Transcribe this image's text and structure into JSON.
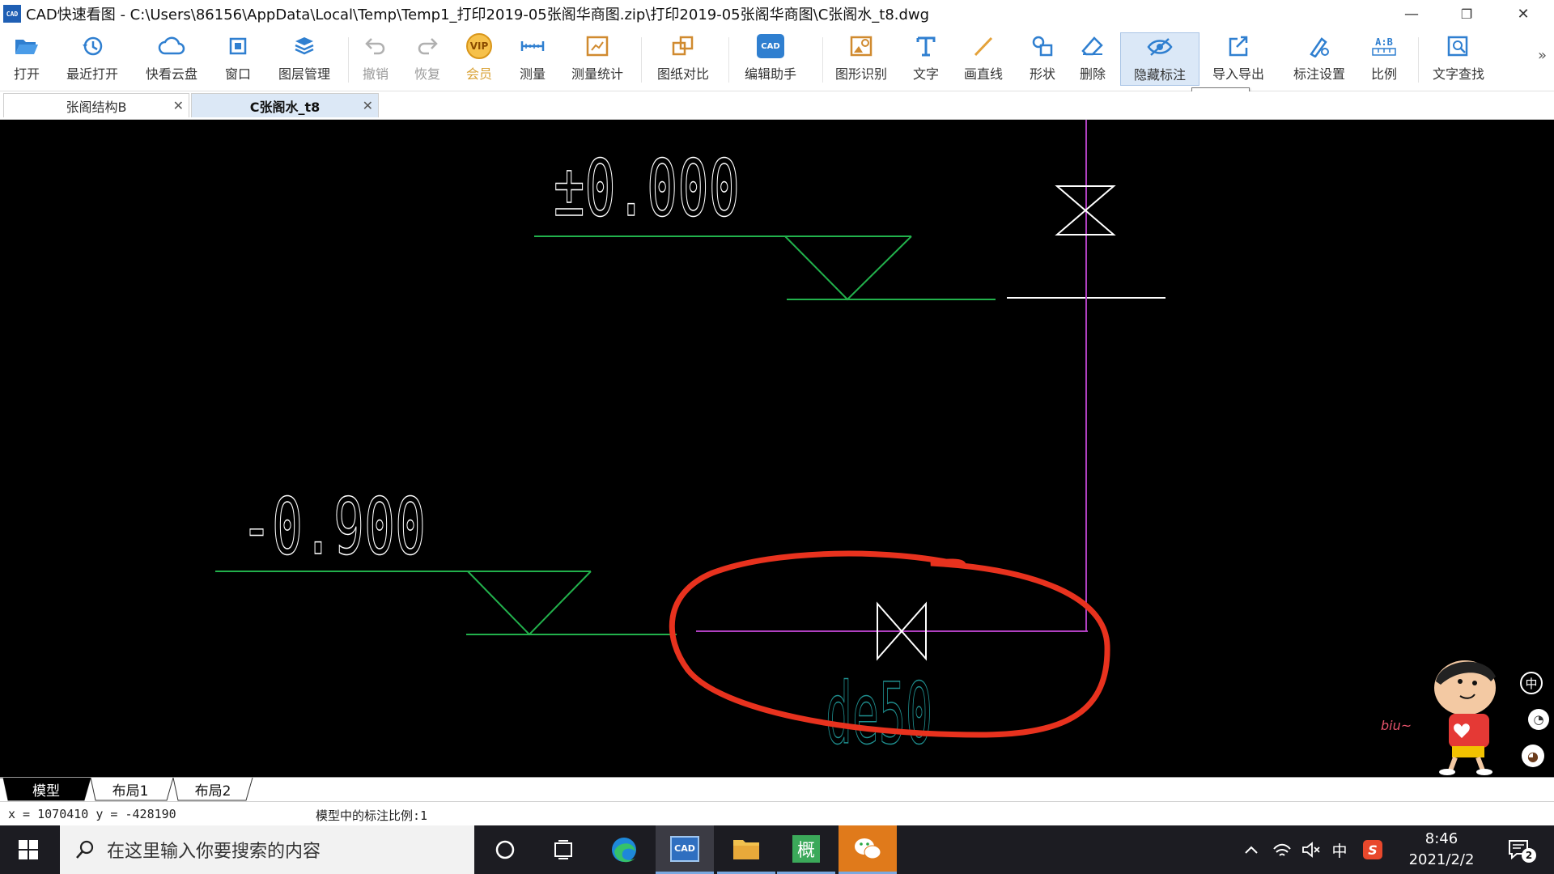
{
  "window": {
    "app_icon_text": "CAD",
    "title": "CAD快速看图 - C:\\Users\\86156\\AppData\\Local\\Temp\\Temp1_打印2019-05张阁华商图.zip\\打印2019-05张阁华商图\\C张阁水_t8.dwg",
    "minimize": "—",
    "restore": "❐",
    "close": "✕"
  },
  "toolbar": {
    "items": [
      {
        "label": "打开",
        "icon": "folder-open-icon"
      },
      {
        "label": "最近打开",
        "icon": "clock-history-icon"
      },
      {
        "label": "快看云盘",
        "icon": "cloud-icon"
      },
      {
        "label": "窗口",
        "icon": "window-icon"
      },
      {
        "label": "图层管理",
        "icon": "layers-icon"
      },
      {
        "label": "撤销",
        "icon": "undo-icon",
        "disabled": true
      },
      {
        "label": "恢复",
        "icon": "redo-icon",
        "disabled": true
      },
      {
        "label": "会员",
        "icon": "vip-icon",
        "badge": "VIP"
      },
      {
        "label": "测量",
        "icon": "ruler-icon"
      },
      {
        "label": "测量统计",
        "icon": "measure-stats-icon"
      },
      {
        "label": "图纸对比",
        "icon": "compare-icon"
      },
      {
        "label": "编辑助手",
        "icon": "edit-assistant-icon",
        "badge": "CAD"
      },
      {
        "label": "图形识别",
        "icon": "shape-recognition-icon"
      },
      {
        "label": "文字",
        "icon": "text-icon"
      },
      {
        "label": "画直线",
        "icon": "line-icon"
      },
      {
        "label": "形状",
        "icon": "shapes-icon"
      },
      {
        "label": "删除",
        "icon": "eraser-icon"
      },
      {
        "label": "隐藏标注",
        "icon": "eye-hide-icon",
        "active": true
      },
      {
        "label": "导入导出",
        "icon": "import-export-icon"
      },
      {
        "label": "标注设置",
        "icon": "annotation-settings-icon"
      },
      {
        "label": "比例",
        "icon": "scale-icon",
        "badge": "A:B"
      },
      {
        "label": "文字查找",
        "icon": "text-search-icon"
      }
    ],
    "overflow": "»",
    "tooltip": "隐藏标注"
  },
  "doc_tabs": [
    {
      "label": "张阁结构B",
      "active": false,
      "close": "✕"
    },
    {
      "label": "C张阁水_t8",
      "active": true,
      "close": "✕"
    }
  ],
  "drawing": {
    "elevation_top": "±0.000",
    "elevation_bottom": "-0.900",
    "pipe_label": "de50",
    "colors": {
      "background": "#000000",
      "text": "#ffffff",
      "elevation_symbol": "#22b14c",
      "pipe": "#b040c0",
      "pipe_label": "#1f8f8f",
      "highlight": "#e8321e"
    }
  },
  "mascot_text": "biu~",
  "side_buttons": [
    "中",
    "◔",
    "◕"
  ],
  "layout_tabs": [
    "模型",
    "布局1",
    "布局2"
  ],
  "status": {
    "coords": "x = 1070410 y = -428190",
    "scale": "模型中的标注比例:1"
  },
  "taskbar": {
    "search_placeholder": "在这里输入你要搜索的内容",
    "apps": [
      "cortana-icon",
      "task-view-icon",
      "edge-icon",
      "cad-viewer-icon",
      "file-explorer-icon",
      "gaitu-icon",
      "wechat-icon"
    ],
    "cad_badge": "CAD",
    "gaitu_badge": "概",
    "tray": {
      "ime": "中",
      "clock_time": "8:46",
      "clock_date": "2021/2/2",
      "notification_count": "2"
    }
  }
}
